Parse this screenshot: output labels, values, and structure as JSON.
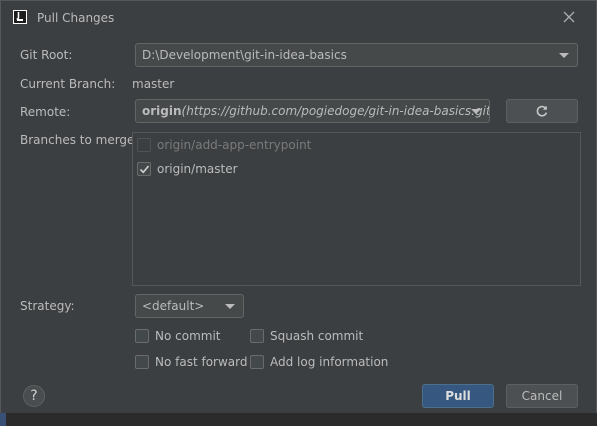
{
  "window": {
    "title": "Pull Changes",
    "app_icon": "intellij-icon",
    "close_icon": "close-icon"
  },
  "form": {
    "git_root_label": "Git Root:",
    "git_root_value": "D:\\Development\\git-in-idea-basics",
    "current_branch_label": "Current Branch:",
    "current_branch_value": "master",
    "remote_label": "Remote:",
    "remote_name": "origin",
    "remote_url": "(https://github.com/pogiedoge/git-in-idea-basics.git)",
    "refresh_icon": "refresh-icon",
    "branches_label": "Branches to merge:",
    "branches": [
      {
        "name": "origin/add-app-entrypoint",
        "checked": false,
        "enabled": false
      },
      {
        "name": "origin/master",
        "checked": true,
        "enabled": true
      }
    ],
    "strategy_label": "Strategy:",
    "strategy_value": "<default>",
    "options": [
      {
        "label": "No commit",
        "checked": false
      },
      {
        "label": "Squash commit",
        "checked": false
      },
      {
        "label": "No fast forward",
        "checked": false
      },
      {
        "label": "Add log information",
        "checked": false
      }
    ]
  },
  "footer": {
    "help_label": "?",
    "pull_label": "Pull",
    "cancel_label": "Cancel"
  },
  "colors": {
    "background": "#3c3f41",
    "text": "#bbbbbb",
    "primary_button": "#365880"
  }
}
